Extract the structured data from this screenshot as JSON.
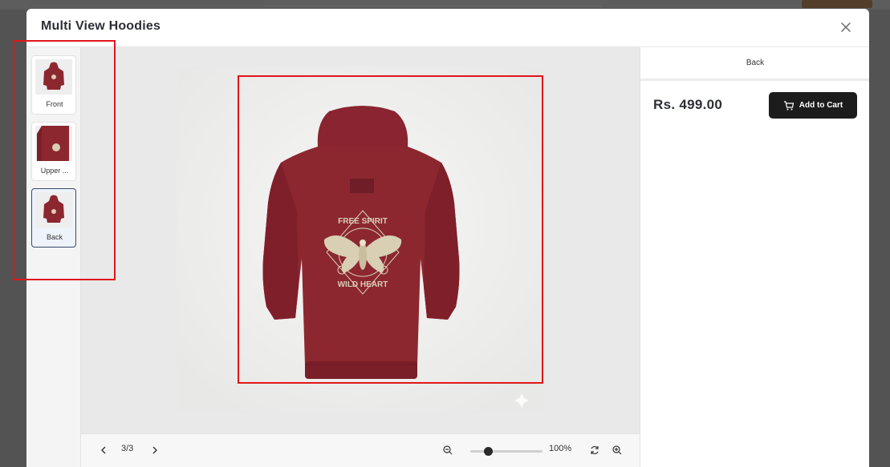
{
  "modal": {
    "title": "Multi View Hoodies"
  },
  "thumbnails": [
    {
      "label": "Front",
      "active": false
    },
    {
      "label": "Upper ...",
      "active": false
    },
    {
      "label": "Back",
      "active": true
    }
  ],
  "viewer": {
    "page_indicator": "3/3",
    "zoom_level": "100%",
    "zoom_fraction": 0.22,
    "print_text_top": "FREE SPIRIT",
    "print_text_bottom": "WILD HEART",
    "product_color": "#8c2730"
  },
  "side_panel": {
    "view_name": "Back",
    "price": "Rs. 499.00",
    "add_to_cart_label": "Add to Cart"
  },
  "icons": {
    "close": "close-icon",
    "prev": "chevron-left-icon",
    "next": "chevron-right-icon",
    "zoom_out": "zoom-out-icon",
    "zoom_in": "zoom-in-icon",
    "reset": "refresh-icon",
    "cart": "cart-icon"
  },
  "colors": {
    "annotation_red": "#e0161b",
    "button_dark": "#1c1c1c",
    "active_border": "#3a4a66"
  }
}
